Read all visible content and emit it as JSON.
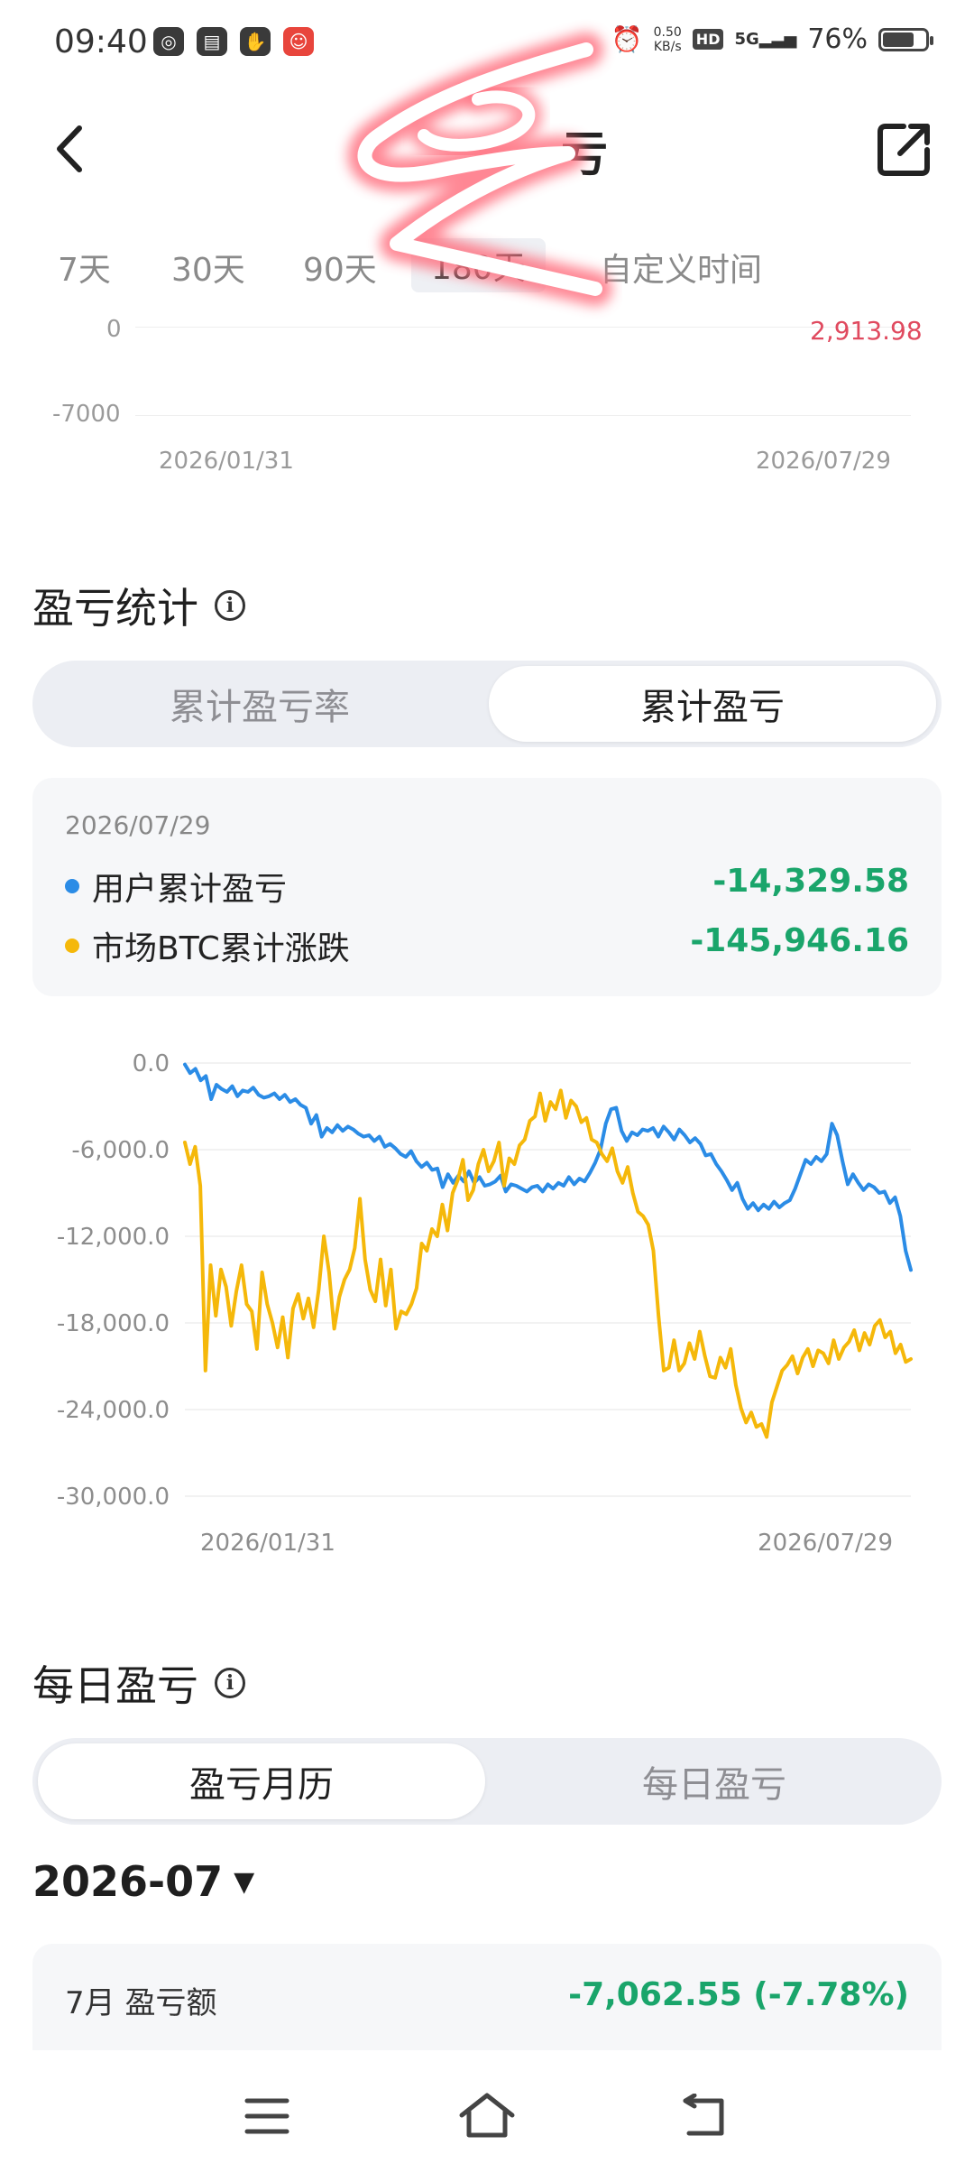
{
  "status_bar": {
    "time": "09:40",
    "net_speed_top": "0.50",
    "net_speed_bottom": "KB/s",
    "hd": "HD",
    "signal": "5G",
    "battery": "76%"
  },
  "header": {
    "title_visible_fragment": "亏"
  },
  "period_tabs": [
    {
      "label": "7天"
    },
    {
      "label": "30天"
    },
    {
      "label": "90天"
    },
    {
      "label": "180天"
    },
    {
      "label": "自定义时间"
    }
  ],
  "upper_chart": {
    "y_labels": [
      "0",
      "-7000"
    ],
    "value_label": "2,913.98",
    "x_start": "2026/01/31",
    "x_end": "2026/07/29"
  },
  "pnl_stats": {
    "title": "盈亏统计",
    "toggle": {
      "options": [
        "累计盈亏率",
        "累计盈亏"
      ],
      "selected": "累计盈亏"
    },
    "legend": {
      "date": "2026/07/29",
      "items": [
        {
          "label": "用户累计盈亏",
          "value": "-14,329.58",
          "color": "#2b8ce6"
        },
        {
          "label": "市场BTC累计涨跌",
          "value": "-145,946.16",
          "color": "#f5b80a"
        }
      ]
    }
  },
  "chart_data": {
    "type": "line",
    "ylim": [
      -30000,
      0
    ],
    "yticks": [
      "0.0",
      "-6,000.0",
      "-12,000.0",
      "-18,000.0",
      "-24,000.0",
      "-30,000.0"
    ],
    "xlabels": [
      "2026/01/31",
      "2026/07/29"
    ],
    "grid": true,
    "series": [
      {
        "name": "用户累计盈亏",
        "color": "#2b8ce6",
        "values": [
          -100,
          -700,
          -400,
          -1200,
          -900,
          -2500,
          -1500,
          -1800,
          -2000,
          -1600,
          -2300,
          -1900,
          -2000,
          -1700,
          -2200,
          -2400,
          -2300,
          -2100,
          -2500,
          -2200,
          -2700,
          -2500,
          -2900,
          -3100,
          -4200,
          -3600,
          -5100,
          -4500,
          -4800,
          -4300,
          -4700,
          -4400,
          -4600,
          -4900,
          -5100,
          -5000,
          -5400,
          -5100,
          -5800,
          -5600,
          -5900,
          -6300,
          -6500,
          -6100,
          -6800,
          -7200,
          -6900,
          -7400,
          -7300,
          -8600,
          -7700,
          -8300,
          -7800,
          -8200,
          -7500,
          -8300,
          -7900,
          -8500,
          -8400,
          -8200,
          -7800,
          -8900,
          -8400,
          -8500,
          -8700,
          -8900,
          -8600,
          -8500,
          -8900,
          -8400,
          -8700,
          -8300,
          -8500,
          -7900,
          -8400,
          -8000,
          -8200,
          -7600,
          -6900,
          -6000,
          -4200,
          -3200,
          -3100,
          -4700,
          -5400,
          -4800,
          -5000,
          -4600,
          -4700,
          -4500,
          -5100,
          -4400,
          -4800,
          -5300,
          -4600,
          -5000,
          -5500,
          -5200,
          -5600,
          -6400,
          -6300,
          -7000,
          -7500,
          -8100,
          -8800,
          -8300,
          -9400,
          -10100,
          -9700,
          -10200,
          -9800,
          -10100,
          -9600,
          -10000,
          -9700,
          -9500,
          -8700,
          -7700,
          -6700,
          -7000,
          -6500,
          -6800,
          -6300,
          -4200,
          -5000,
          -6800,
          -8400,
          -7700,
          -8300,
          -8800,
          -8400,
          -8600,
          -9000,
          -8900,
          -9700,
          -9300,
          -10600,
          -13000,
          -14329
        ]
      },
      {
        "name": "市场BTC累计涨跌",
        "color": "#f5b80a",
        "values": [
          -5500,
          -7000,
          -5800,
          -8500,
          -21300,
          -14000,
          -17500,
          -14300,
          -15500,
          -18200,
          -15800,
          -14000,
          -16700,
          -17200,
          -19800,
          -14500,
          -16700,
          -18000,
          -19700,
          -17600,
          -20400,
          -17000,
          -16000,
          -17700,
          -16300,
          -18300,
          -15700,
          -12000,
          -14500,
          -18400,
          -16200,
          -15000,
          -14300,
          -12800,
          -9400,
          -13600,
          -15700,
          -16500,
          -13600,
          -16800,
          -14300,
          -18400,
          -17200,
          -17400,
          -16700,
          -15600,
          -12500,
          -13000,
          -11500,
          -12000,
          -9800,
          -11600,
          -9000,
          -8100,
          -6700,
          -9500,
          -8800,
          -7000,
          -6000,
          -7500,
          -6800,
          -5500,
          -8500,
          -6600,
          -7000,
          -5700,
          -5300,
          -4000,
          -3700,
          -2100,
          -4000,
          -2700,
          -3200,
          -1900,
          -3800,
          -2600,
          -3000,
          -4100,
          -3800,
          -5300,
          -5500,
          -6300,
          -6800,
          -5900,
          -7500,
          -8300,
          -7200,
          -9000,
          -10300,
          -10600,
          -11200,
          -13000,
          -17500,
          -21300,
          -21100,
          -19200,
          -21300,
          -20800,
          -19400,
          -20500,
          -18600,
          -20300,
          -21700,
          -21800,
          -20400,
          -21100,
          -19800,
          -22300,
          -23900,
          -24900,
          -24200,
          -25200,
          -25000,
          -25900,
          -23500,
          -22400,
          -21300,
          -20900,
          -20300,
          -21500,
          -20400,
          -19800,
          -21000,
          -19900,
          -20100,
          -20800,
          -19200,
          -20500,
          -19700,
          -19300,
          -18500,
          -19900,
          -18700,
          -19500,
          -18200,
          -17800,
          -19000,
          -18600,
          -20100,
          -19500,
          -20700,
          -20500
        ]
      }
    ]
  },
  "daily_pnl": {
    "title": "每日盈亏",
    "toggle": {
      "options": [
        "盈亏月历",
        "每日盈亏"
      ],
      "selected": "盈亏月历"
    },
    "month": "2026-07",
    "summary_label": "7月 盈亏额",
    "summary_value": "-7,062.55 (-7.78%)"
  }
}
